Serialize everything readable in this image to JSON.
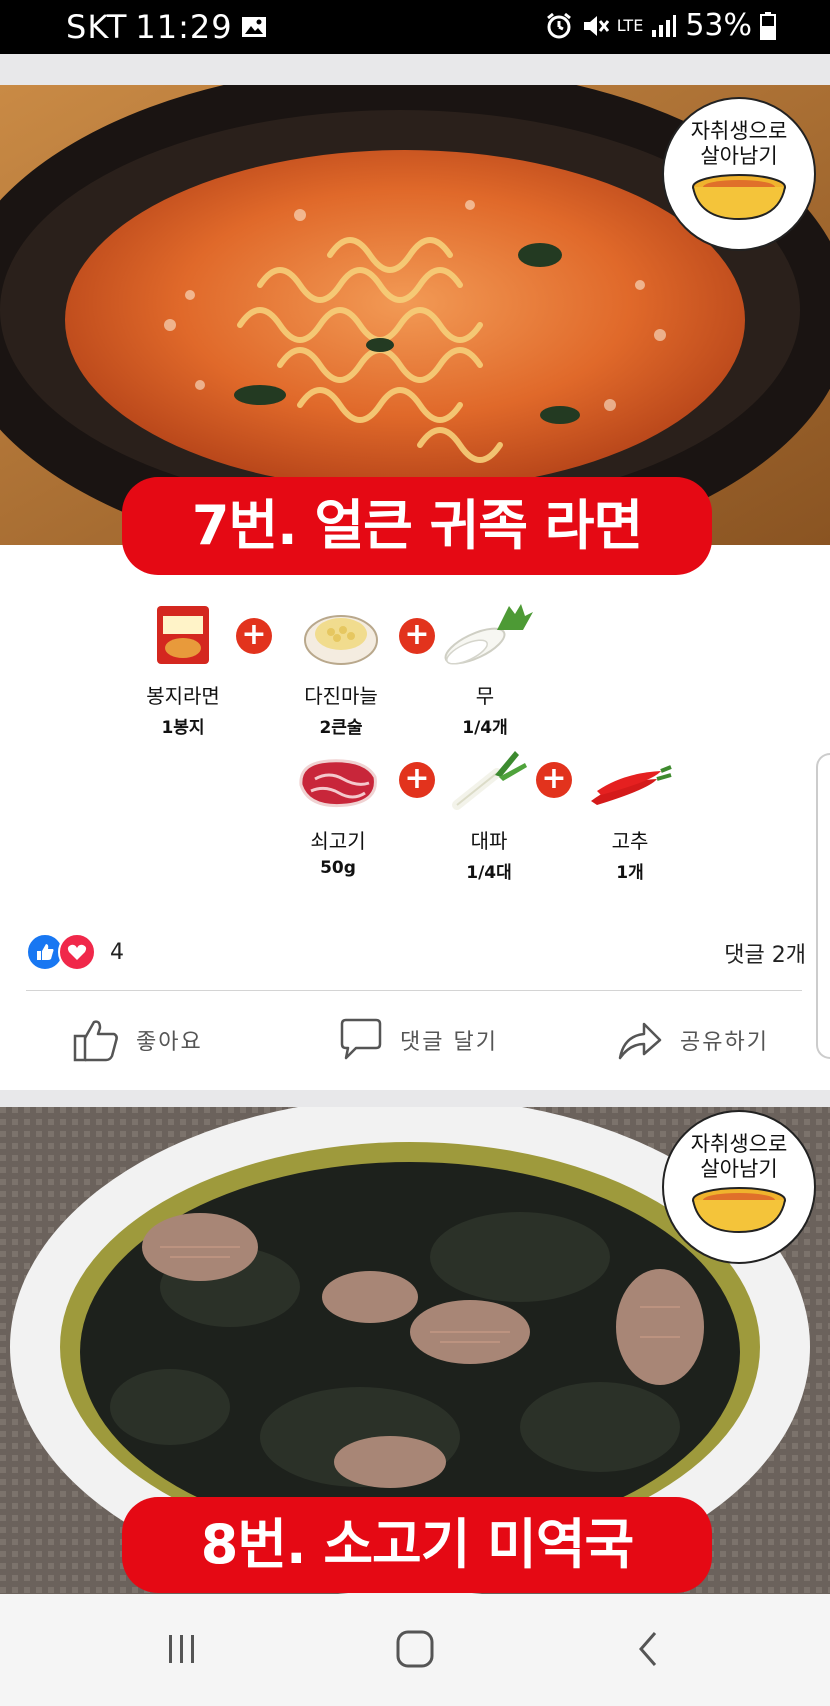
{
  "status_bar": {
    "carrier": "SKT",
    "time": "11:29",
    "network": "LTE",
    "battery": "53%",
    "icons": [
      "image-icon",
      "alarm-icon",
      "mute-icon",
      "signal-icon",
      "battery-icon"
    ]
  },
  "post1": {
    "badge_line1": "자취생으로",
    "badge_line2": "살아남기",
    "title": "7번. 얼큰 귀족 라면",
    "ingredients": [
      {
        "name": "봉지라면",
        "amount": "1봉지",
        "icon": "ramen-pack-icon"
      },
      {
        "name": "다진마늘",
        "amount": "2큰술",
        "icon": "garlic-icon"
      },
      {
        "name": "무",
        "amount": "1/4개",
        "icon": "radish-icon"
      },
      {
        "name": "쇠고기",
        "amount": "50g",
        "icon": "beef-icon"
      },
      {
        "name": "대파",
        "amount": "1/4대",
        "icon": "green-onion-icon"
      },
      {
        "name": "고추",
        "amount": "1개",
        "icon": "chili-icon"
      }
    ],
    "reaction_count": "4",
    "comment_count": "댓글 2개",
    "actions": {
      "like": "좋아요",
      "comment": "댓글 달기",
      "share": "공유하기"
    }
  },
  "post2": {
    "badge_line1": "자취생으로",
    "badge_line2": "살아남기",
    "title": "8번. 소고기 미역국"
  },
  "colors": {
    "banner_red": "#e50914",
    "plus_red": "#e2331d",
    "like_blue": "#1877f2",
    "love_red": "#f0284a"
  }
}
